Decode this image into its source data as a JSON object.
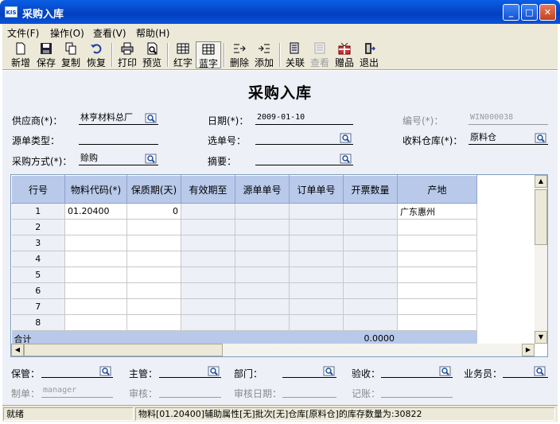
{
  "window": {
    "title": "采购入库",
    "app_icon": "KIS"
  },
  "menu": [
    "文件(F)",
    "操作(O)",
    "查看(V)",
    "帮助(H)"
  ],
  "toolbar": [
    {
      "label": "新增",
      "icon": "new-doc-icon"
    },
    {
      "label": "保存",
      "icon": "floppy-icon"
    },
    {
      "label": "复制",
      "icon": "copy-icon"
    },
    {
      "label": "恢复",
      "icon": "undo-icon"
    },
    {
      "label": "打印",
      "icon": "printer-icon"
    },
    {
      "label": "预览",
      "icon": "preview-icon"
    },
    {
      "label": "红字",
      "icon": "grid-red-icon"
    },
    {
      "label": "蓝字",
      "icon": "grid-blue-icon",
      "pressed": true
    },
    {
      "label": "删除",
      "icon": "delete-row-icon"
    },
    {
      "label": "添加",
      "icon": "add-row-icon"
    },
    {
      "label": "关联",
      "icon": "link-icon"
    },
    {
      "label": "查看",
      "icon": "view-icon",
      "disabled": true
    },
    {
      "label": "赠品",
      "icon": "gift-icon"
    },
    {
      "label": "退出",
      "icon": "exit-icon"
    }
  ],
  "form": {
    "title": "采购入库",
    "supplier_label": "供应商(*)：",
    "supplier_value": "林亨材料总厂",
    "date_label": "日期(*)：",
    "date_value": "2009-01-10",
    "number_label": "编号(*)：",
    "number_value": "WIN000038",
    "source_type_label": "源单类型：",
    "select_no_label": "选单号：",
    "warehouse_label": "收料仓库(*)：",
    "warehouse_value": "原料仓",
    "purchase_mode_label": "采购方式(*)：",
    "purchase_mode_value": "赊购",
    "summary_label": "摘要："
  },
  "grid": {
    "columns": [
      "行号",
      "物料代码(*)",
      "保质期(天)",
      "有效期至",
      "源单单号",
      "订单单号",
      "开票数量",
      "产地"
    ],
    "rows": [
      [
        "1",
        "01.20400",
        "0",
        "",
        "",
        "",
        "",
        "广东惠州"
      ],
      [
        "2",
        "",
        "",
        "",
        "",
        "",
        "",
        ""
      ],
      [
        "3",
        "",
        "",
        "",
        "",
        "",
        "",
        ""
      ],
      [
        "4",
        "",
        "",
        "",
        "",
        "",
        "",
        ""
      ],
      [
        "5",
        "",
        "",
        "",
        "",
        "",
        "",
        ""
      ],
      [
        "6",
        "",
        "",
        "",
        "",
        "",
        "",
        ""
      ],
      [
        "7",
        "",
        "",
        "",
        "",
        "",
        "",
        ""
      ],
      [
        "8",
        "",
        "",
        "",
        "",
        "",
        "",
        ""
      ]
    ],
    "total_label": "合计",
    "total_value": "0.0000"
  },
  "footer": {
    "keeper_label": "保管：",
    "supervisor_label": "主管：",
    "dept_label": "部门：",
    "inspect_label": "验收：",
    "salesman_label": "业务员：",
    "maker_label": "制单：",
    "maker_value": "manager",
    "audit_label": "审核：",
    "audit_date_label": "审核日期：",
    "posting_label": "记账："
  },
  "status": {
    "left": "就绪",
    "message": "物料[01.20400]辅助属性[无]批次[无]仓库[原料仓]的库存数量为:30822"
  }
}
